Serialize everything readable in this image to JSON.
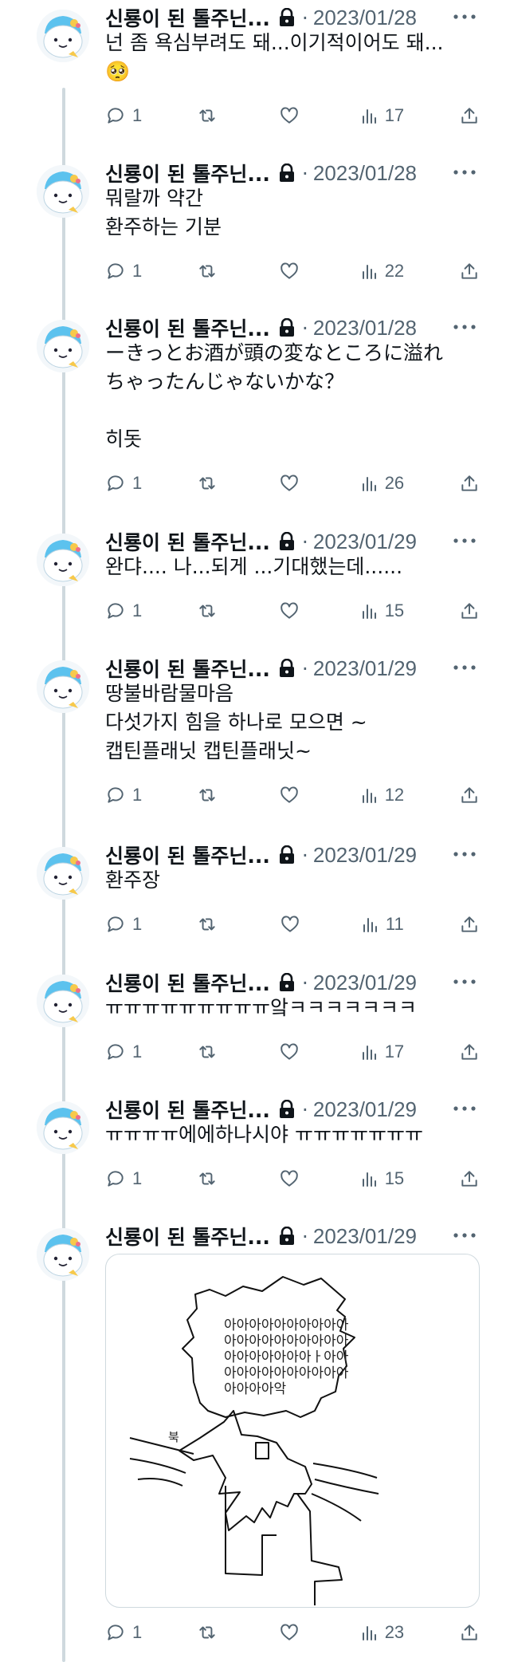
{
  "account": {
    "display_name": "신룡이 된 톨주닌...",
    "separator": "·",
    "protected_icon": "lock-icon",
    "avatar_icon": "blue-hat-bear-avatar"
  },
  "tweets": [
    {
      "date": "2023/01/28",
      "text": "넌 좀 욕심부려도 돼...이기적이어도 돼...\n🥺",
      "replies": "1",
      "views": "17"
    },
    {
      "date": "2023/01/28",
      "text": "뭐랄까 약간\n환주하는 기분",
      "replies": "1",
      "views": "22"
    },
    {
      "date": "2023/01/28",
      "text": "ーきっとお酒が頭の変なところに溢れ\nちゃったんじゃないかな？\n\n히돗",
      "replies": "1",
      "views": "26"
    },
    {
      "date": "2023/01/29",
      "text": "완댜.... 나...되게 ...기대했는데......",
      "replies": "1",
      "views": "15"
    },
    {
      "date": "2023/01/29",
      "text": "땅불바람물마음\n다섯가지 힘을 하나로 모으면 ~\n캡틴플래닛 캡틴플래닛~",
      "replies": "1",
      "views": "12"
    },
    {
      "date": "2023/01/29",
      "text": "환주장",
      "replies": "1",
      "views": "11"
    },
    {
      "date": "2023/01/29",
      "text": "ㅠㅠㅠㅠㅠㅠㅠㅠㅠ앜ㅋㅋㅋㅋㅋㅋㅋ",
      "replies": "1",
      "views": "17"
    },
    {
      "date": "2023/01/29",
      "text": "ㅠㅠㅠㅠ에에하나시야 ㅠㅠㅠㅠㅠㅠㅠ",
      "replies": "1",
      "views": "15"
    },
    {
      "date": "2023/01/29",
      "text": "",
      "replies": "1",
      "views": "23",
      "media": {
        "speech_lines": [
          "아아아아아아아아아아",
          "아아아아아아아아아아",
          "아아아아아아아ㅏ아아",
          "아아아아아아아아아아",
          "아아아아악"
        ],
        "label": "북"
      }
    }
  ],
  "icons": {
    "reply": "reply-icon",
    "retweet": "retweet-icon",
    "like": "heart-icon",
    "views": "views-chart-icon",
    "share": "share-icon",
    "more": "more-icon"
  }
}
